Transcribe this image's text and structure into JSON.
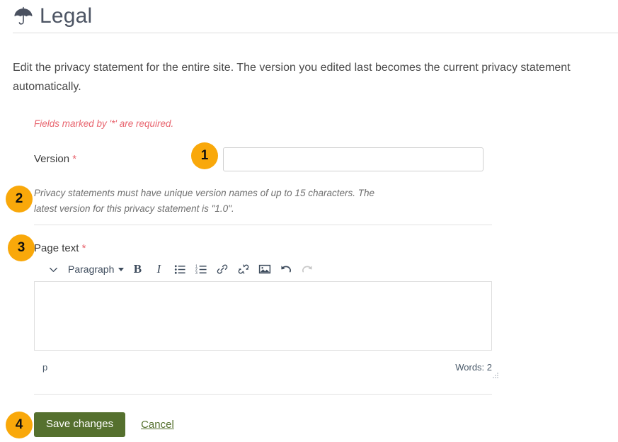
{
  "header": {
    "icon": "umbrella-icon",
    "title": "Legal"
  },
  "intro": "Edit the privacy statement for the entire site. The version you edited last becomes the current privacy statement automatically.",
  "form": {
    "required_note": "Fields marked by '*' are required.",
    "version": {
      "label": "Version",
      "required_marker": "*",
      "value": "",
      "placeholder": "",
      "help": "Privacy statements must have unique version names of up to 15 characters. The latest version for this privacy statement is \"1.0\"."
    },
    "page_text": {
      "label": "Page text",
      "required_marker": "*",
      "value": ""
    },
    "actions": {
      "save_label": "Save changes",
      "cancel_label": "Cancel"
    }
  },
  "editor": {
    "format_label": "Paragraph",
    "toolbar": [
      {
        "name": "collapse-toolbar-icon",
        "label": ""
      },
      {
        "name": "format-select",
        "label": "Paragraph"
      },
      {
        "name": "bold-icon",
        "label": "B"
      },
      {
        "name": "italic-icon",
        "label": "I"
      },
      {
        "name": "bullet-list-icon",
        "label": ""
      },
      {
        "name": "numbered-list-icon",
        "label": ""
      },
      {
        "name": "link-icon",
        "label": ""
      },
      {
        "name": "unlink-icon",
        "label": ""
      },
      {
        "name": "image-icon",
        "label": ""
      },
      {
        "name": "undo-icon",
        "label": ""
      },
      {
        "name": "redo-icon",
        "label": ""
      }
    ],
    "status_path": "p",
    "word_count": "Words: 2"
  },
  "callouts": [
    {
      "number": "1",
      "target": "version-input"
    },
    {
      "number": "2",
      "target": "version-help"
    },
    {
      "number": "3",
      "target": "page-text-label"
    },
    {
      "number": "4",
      "target": "save-button"
    }
  ],
  "colors": {
    "accent_orange": "#f9a80a",
    "button_green": "#55702e",
    "required_red": "#e8636d",
    "title_gray": "#4c5463"
  }
}
